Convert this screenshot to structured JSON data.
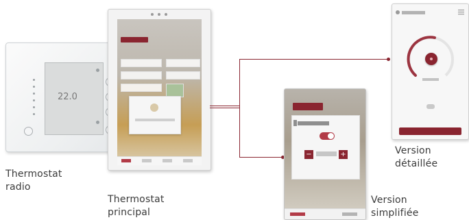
{
  "labels": {
    "radio": "Thermostat\nradio",
    "principal": "Thermostat\nprincipal",
    "simple": "Version\nsimplifiée",
    "detailed": "Version\ndétaillée"
  },
  "radio_device": {
    "temperature": "22.0"
  },
  "colors": {
    "accent": "#8a2530",
    "accent_light": "#b23b47",
    "text": "#3a3a3a"
  }
}
